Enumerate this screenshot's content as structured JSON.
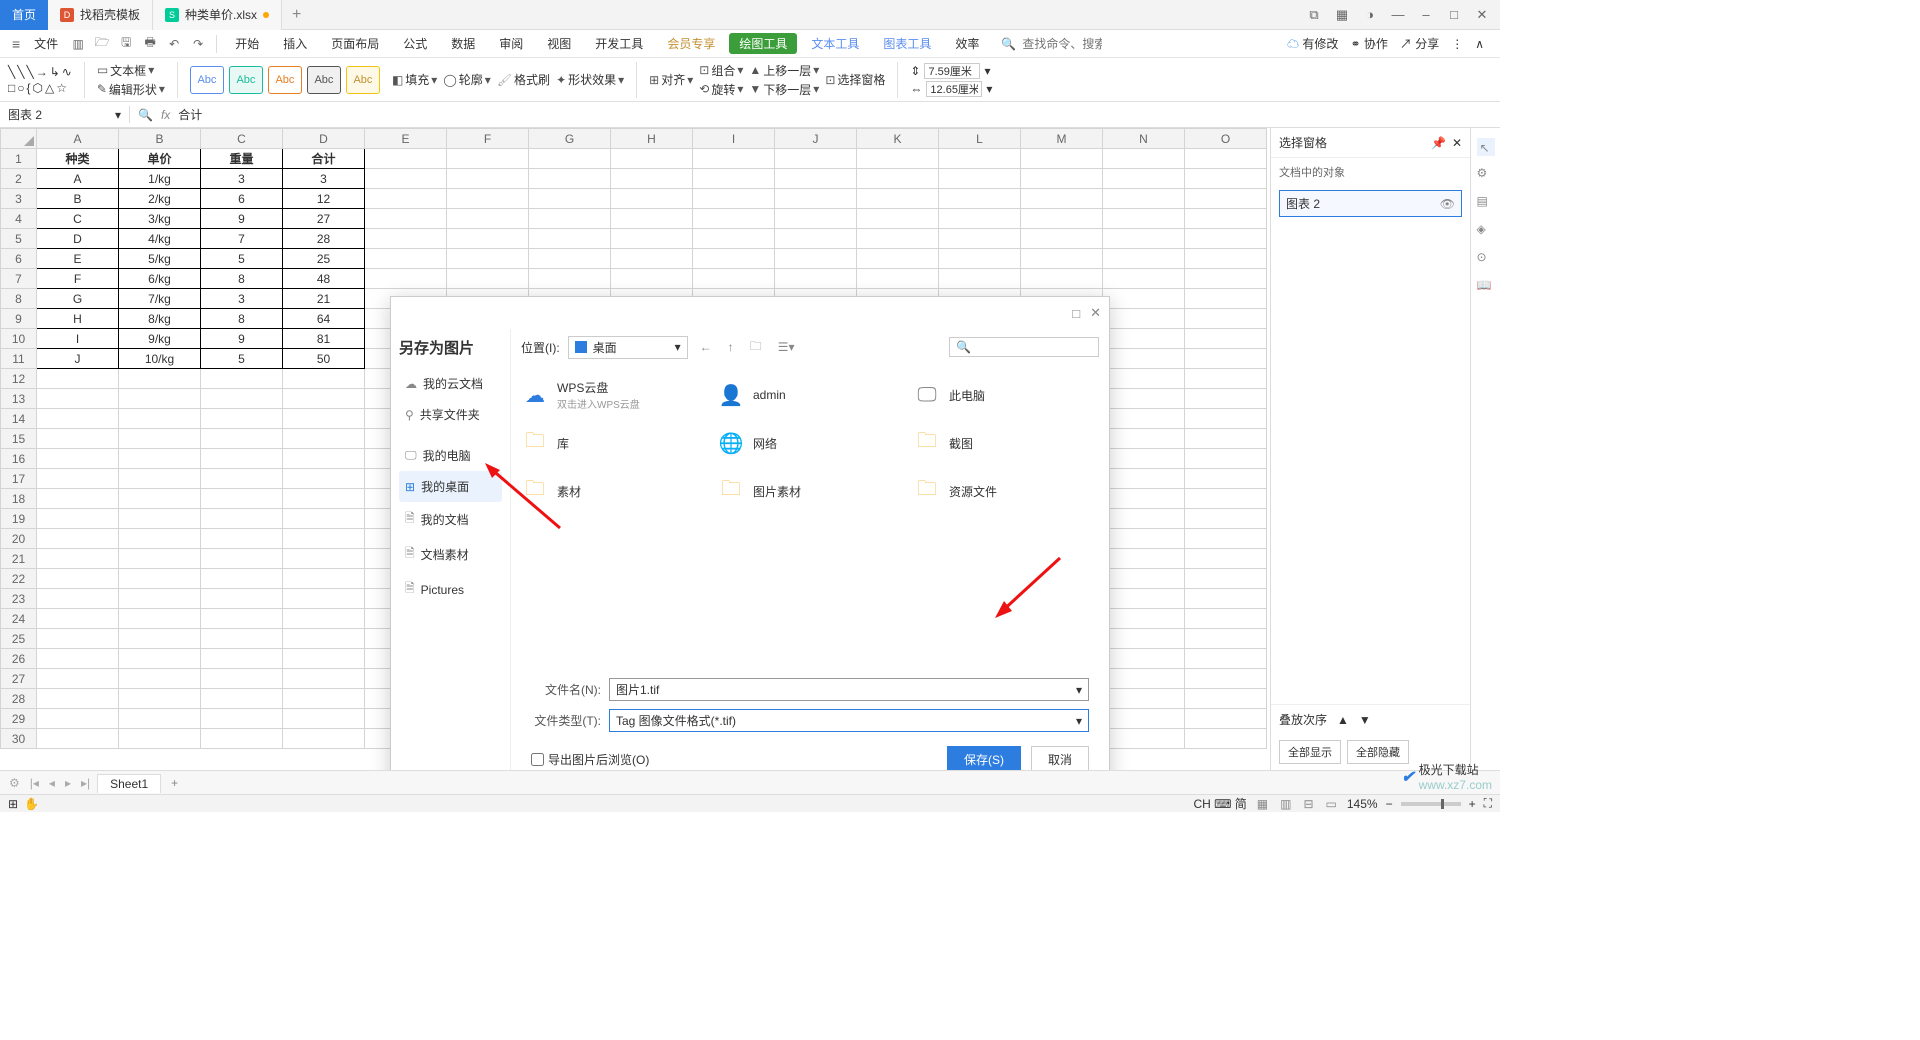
{
  "tabs": {
    "home": "首页",
    "tpl": "找稻壳模板",
    "doc": "种类单价.xlsx"
  },
  "menu": {
    "file": "文件",
    "items": [
      "开始",
      "插入",
      "页面布局",
      "公式",
      "数据",
      "审阅",
      "视图",
      "开发工具",
      "会员专享",
      "绘图工具",
      "文本工具",
      "图表工具",
      "效率"
    ],
    "searchPlaceholder": "查找命令、搜索模板",
    "right": {
      "modify": "有修改",
      "collab": "协作",
      "share": "分享"
    }
  },
  "ribbon": {
    "textbox": "文本框",
    "editshape": "编辑形状",
    "fill": "填充",
    "outline": "轮廓",
    "effect": "形状效果",
    "align": "对齐",
    "group": "组合",
    "rotate": "旋转",
    "fmt": "格式刷",
    "up": "上移一层",
    "down": "下移一层",
    "selpane": "选择窗格",
    "w": "7.59厘米",
    "h": "12.65厘米"
  },
  "formula": {
    "name": "图表 2",
    "fx": "合计"
  },
  "sheet": {
    "cols": [
      "A",
      "B",
      "C",
      "D",
      "E",
      "F",
      "G",
      "H",
      "I",
      "J",
      "K",
      "L",
      "M",
      "N",
      "O"
    ],
    "headers": [
      "种类",
      "单价",
      "重量",
      "合计"
    ],
    "rows": [
      [
        "A",
        "1/kg",
        "3",
        "3"
      ],
      [
        "B",
        "2/kg",
        "6",
        "12"
      ],
      [
        "C",
        "3/kg",
        "9",
        "27"
      ],
      [
        "D",
        "4/kg",
        "7",
        "28"
      ],
      [
        "E",
        "5/kg",
        "5",
        "25"
      ],
      [
        "F",
        "6/kg",
        "8",
        "48"
      ],
      [
        "G",
        "7/kg",
        "3",
        "21"
      ],
      [
        "H",
        "8/kg",
        "8",
        "64"
      ],
      [
        "I",
        "9/kg",
        "9",
        "81"
      ],
      [
        "J",
        "10/kg",
        "5",
        "50"
      ]
    ]
  },
  "pane": {
    "title": "选择窗格",
    "sub": "文档中的对象",
    "item": "图表 2",
    "order": "叠放次序",
    "showall": "全部显示",
    "hideall": "全部隐藏"
  },
  "dialog": {
    "title": "另存为图片",
    "loc": "位置(I):",
    "locval": "桌面",
    "side": [
      "我的云文档",
      "共享文件夹",
      "我的电脑",
      "我的桌面",
      "我的文档",
      "文档素材",
      "Pictures"
    ],
    "files": [
      {
        "n": "WPS云盘",
        "s": "双击进入WPS云盘",
        "i": "cloud"
      },
      {
        "n": "admin",
        "i": "user"
      },
      {
        "n": "此电脑",
        "i": "pc"
      },
      {
        "n": "库",
        "i": "folder"
      },
      {
        "n": "网络",
        "i": "net"
      },
      {
        "n": "截图",
        "i": "folder"
      },
      {
        "n": "素材",
        "i": "folder"
      },
      {
        "n": "图片素材",
        "i": "folder"
      },
      {
        "n": "资源文件",
        "i": "folder"
      }
    ],
    "fname": "文件名(N):",
    "fnameVal": "图片1.tif",
    "ftype": "文件类型(T):",
    "ftypeVal": "Tag 图像文件格式(*.tif)",
    "export": "导出图片后浏览(O)",
    "save": "保存(S)",
    "cancel": "取消"
  },
  "sheettab": "Sheet1",
  "status": {
    "zoom": "145%",
    "ime": "CH ⌨ 简"
  },
  "watermark": {
    "site": "极光下载站",
    "url": "www.xz7.com"
  }
}
